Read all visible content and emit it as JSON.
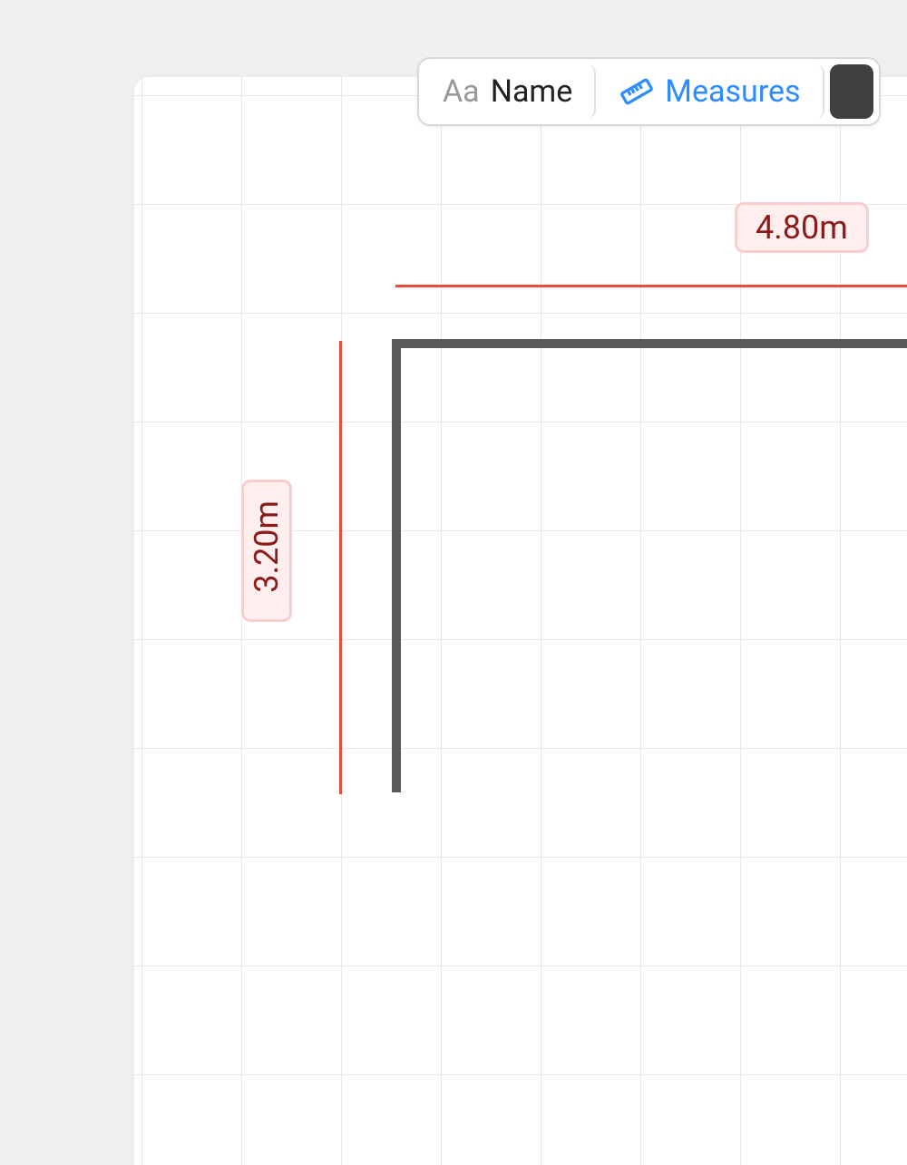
{
  "toolbar": {
    "name_label": "Name",
    "name_icon_text": "Aa",
    "measures_label": "Measures"
  },
  "dimensions": {
    "top": "4.80m",
    "left": "3.20m"
  },
  "colors": {
    "wall": "#5a5a5a",
    "dimension_line": "#e74c3c",
    "dimension_text": "#8b1a1a",
    "dimension_bg": "#feeeee",
    "dimension_border": "#f7cdcd",
    "accent": "#2d8cff"
  }
}
